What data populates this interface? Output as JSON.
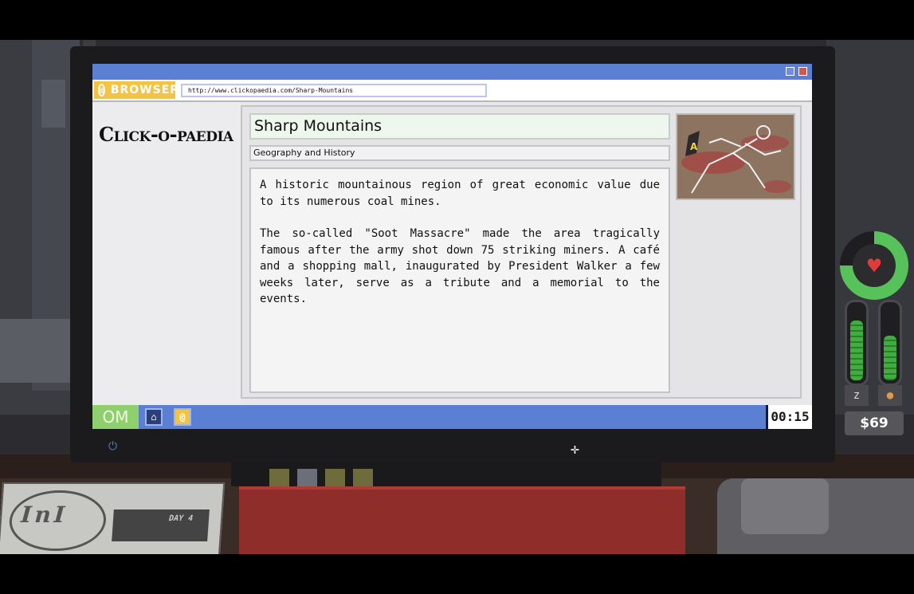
{
  "browser": {
    "tab_label": "BROWSER",
    "tab_icon": "browser-icon",
    "url": "http://www.clickopaedia.com/Sharp-Mountains"
  },
  "site": {
    "title": "Click-o-paedia"
  },
  "article": {
    "title": "Sharp Mountains",
    "category": "Geography and History",
    "paragraphs": [
      "A historic mountainous region of great economic value due to its numerous coal mines.",
      "The so-called \"Soot Massacre\" made the area tragically famous after the army shot down 75 striking miners. A café and a shopping mall, inaugurated by President Walker a few weeks later, serve as a tribute and a memorial to the events."
    ],
    "image_marker": "A"
  },
  "taskbar": {
    "logo": "OM",
    "clock": "00:15"
  },
  "desk": {
    "newspaper_logo": "InI",
    "newspaper_day": "DAY 4"
  },
  "hud": {
    "health_fraction": 0.75,
    "sleep_level": 0.8,
    "food_level": 0.6,
    "sleep_icon": "zzz-icon",
    "food_icon": "drumstick-icon",
    "money": "$69"
  },
  "colors": {
    "titlebar": "#5b7fd3",
    "browser_tab": "#f3c443",
    "om_logo": "#8fd06d",
    "health": "#57c25a",
    "heart": "#e23b3b"
  }
}
